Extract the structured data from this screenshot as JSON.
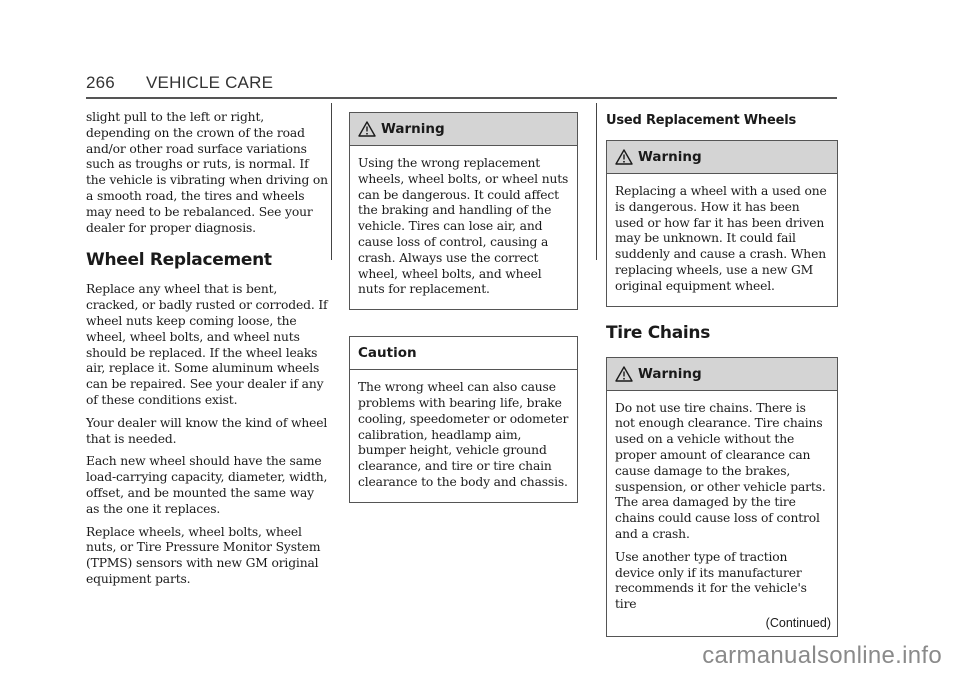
{
  "header": {
    "page_number": "266",
    "section": "VEHICLE CARE"
  },
  "column1": {
    "intro_paragraph": "slight pull to the left or right, depending on the crown of the road and/or other road surface variations such as troughs or ruts, is normal. If the vehicle is vibrating when driving on a smooth road, the tires and wheels may need to be rebalanced. See your dealer for proper diagnosis.",
    "heading": "Wheel Replacement",
    "paragraphs": [
      "Replace any wheel that is bent, cracked, or badly rusted or corroded. If wheel nuts keep coming loose, the wheel, wheel bolts, and wheel nuts should be replaced. If the wheel leaks air, replace it. Some aluminum wheels can be repaired. See your dealer if any of these conditions exist.",
      "Your dealer will know the kind of wheel that is needed.",
      "Each new wheel should have the same load-carrying capacity, diameter, width, offset, and be mounted the same way as the one it replaces.",
      "Replace wheels, wheel bolts, wheel nuts, or Tire Pressure Monitor System (TPMS) sensors with new GM original equipment parts."
    ]
  },
  "column2": {
    "warning": {
      "title": "Warning",
      "icon": "warning-triangle-icon",
      "body": "Using the wrong replacement wheels, wheel bolts, or wheel nuts can be dangerous. It could affect the braking and handling of the vehicle. Tires can lose air, and cause loss of control, causing a crash. Always use the correct wheel, wheel bolts, and wheel nuts for replacement."
    },
    "caution": {
      "title": "Caution",
      "body": "The wrong wheel can also cause problems with bearing life, brake cooling, speedometer or odometer calibration, headlamp aim, bumper height, vehicle ground clearance, and tire or tire chain clearance to the body and chassis."
    }
  },
  "column3": {
    "subheading": "Used Replacement Wheels",
    "warning1": {
      "title": "Warning",
      "icon": "warning-triangle-icon",
      "body": "Replacing a wheel with a used one is dangerous. How it has been used or how far it has been driven may be unknown. It could fail suddenly and cause a crash. When replacing wheels, use a new GM original equipment wheel."
    },
    "heading": "Tire Chains",
    "warning2": {
      "title": "Warning",
      "icon": "warning-triangle-icon",
      "body1": "Do not use tire chains. There is not enough clearance. Tire chains used on a vehicle without the proper amount of clearance can cause damage to the brakes, suspension, or other vehicle parts. The area damaged by the tire chains could cause loss of control and a crash.",
      "body2": "Use another type of traction device only if its manufacturer recommends it for the vehicle's tire",
      "continued": "(Continued)"
    }
  },
  "watermark": "carmanualsonline.info",
  "colors": {
    "warning_header_bg": "#d4d4d4",
    "rule": "#555555",
    "watermark": "#8a8a8a"
  }
}
